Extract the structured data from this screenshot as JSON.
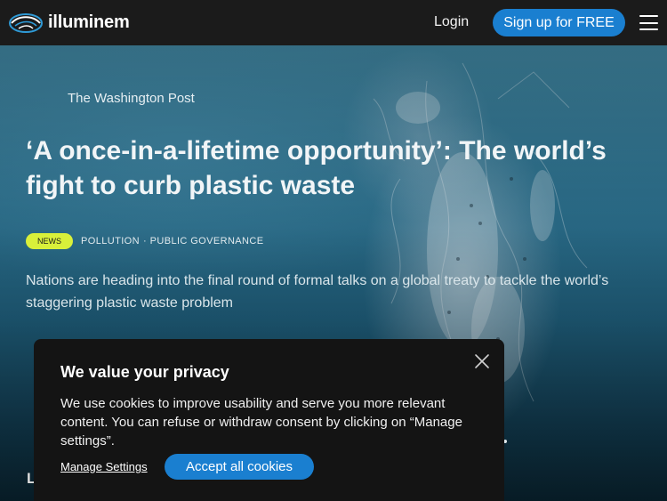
{
  "nav": {
    "brand_name": "illuminem",
    "login_label": "Login",
    "signup_label": "Sign up for FREE",
    "menu_icon": "hamburger-menu-icon"
  },
  "article": {
    "source": "The Washington Post",
    "headline": "‘A once-in-a-lifetime opportunity’: The world’s fight to curb plastic waste",
    "badge": "NEWS",
    "topics": [
      "POLLUTION",
      "PUBLIC GOVERNANCE"
    ],
    "topic_separator": "·",
    "summary": "Nations are heading into the final round of formal talks on a global treaty to tackle the world’s staggering plastic waste problem",
    "partial_heading": "L"
  },
  "cookie_banner": {
    "title": "We value your privacy",
    "text": "We use cookies to improve usability and serve you more relevant content. You can refuse or withdraw consent by clicking on “Manage settings”.",
    "manage_label": "Manage Settings",
    "accept_label": "Accept all cookies",
    "close_icon": "close-icon"
  },
  "colors": {
    "accent": "#1a7fd0",
    "badge": "#d9f03a",
    "topbar": "#1b1b1b",
    "modal": "#141414"
  }
}
